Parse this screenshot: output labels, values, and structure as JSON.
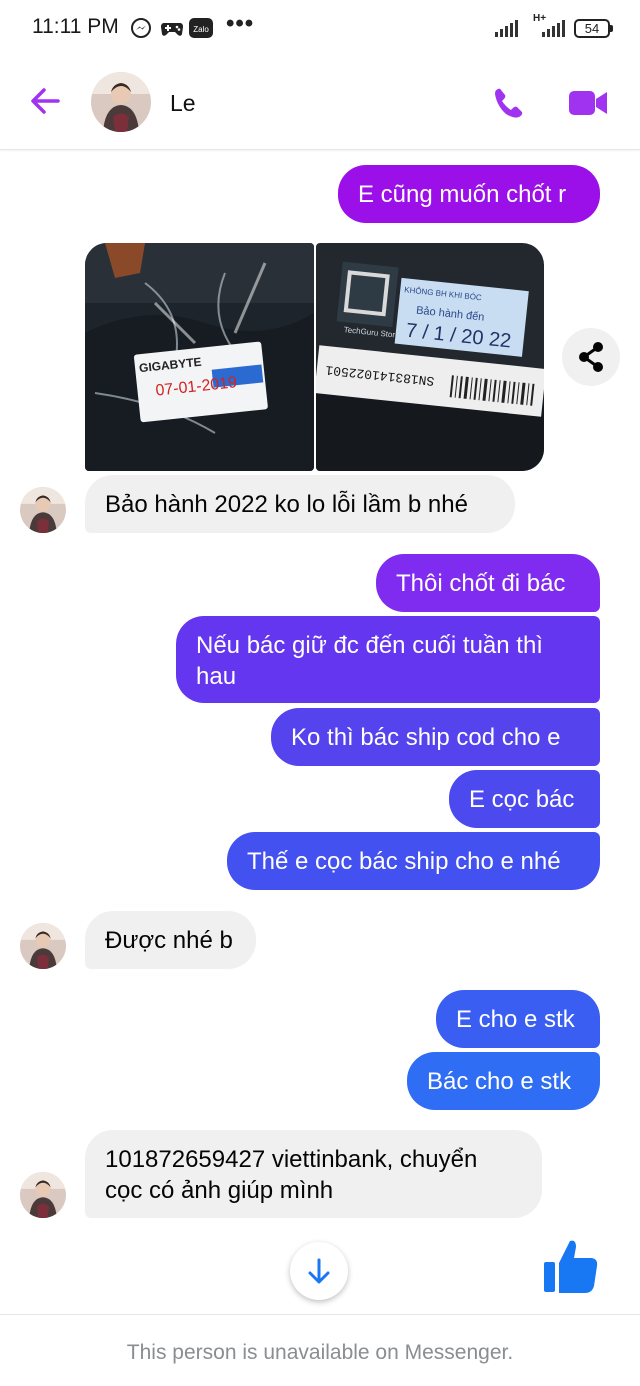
{
  "status_bar": {
    "time": "11:11 PM",
    "app_icons": [
      "messenger-icon",
      "game-controller-icon",
      "zalo-icon"
    ],
    "zalo_label": "Zalo",
    "more": "•••",
    "network": "H+",
    "battery": "54"
  },
  "header": {
    "contact_name": "Le",
    "icons": [
      "back-arrow-icon",
      "phone-icon",
      "video-camera-icon"
    ],
    "accent_color": "#a033f0"
  },
  "messages": [
    {
      "side": "out",
      "text": "E cũng muốn chốt r"
    },
    {
      "side": "in",
      "type": "photos",
      "photo1_brand": "GIGABYTE",
      "photo1_date": "07-01-2019",
      "photo2_line1": "KHÔNG BH KHI BÓC",
      "photo2_line2": "Bảo hành đến",
      "photo2_date": "7 / 1 / 20 22",
      "photo2_store": "TechGuru Store",
      "photo2_serial": "SN183141022501"
    },
    {
      "side": "in",
      "text": "Bảo hành 2022 ko lo lỗi lầm b nhé"
    },
    {
      "side": "out",
      "text": "Thôi chốt đi bác"
    },
    {
      "side": "out",
      "lines": [
        "Nếu bác giữ đc đến cuối tuần thì",
        "hau"
      ]
    },
    {
      "side": "out",
      "text": "Ko thì bác ship cod cho e"
    },
    {
      "side": "out",
      "text": "E cọc bác"
    },
    {
      "side": "out",
      "text": "Thế e cọc bác ship cho e nhé"
    },
    {
      "side": "in",
      "text": "Được nhé b"
    },
    {
      "side": "out",
      "text": "E cho e stk"
    },
    {
      "side": "out",
      "text": "Bác cho e stk"
    },
    {
      "side": "in",
      "lines": [
        "101872659427 viettinbank, chuyển",
        "cọc có ảnh giúp mình"
      ]
    }
  ],
  "bubble_colors": {
    "incoming": "#f0f0f0",
    "outgoing_gradient": [
      "#9b0fe8",
      "#7f2cf0",
      "#5b40ee",
      "#3f55f0",
      "#2f6df5"
    ]
  },
  "controls": {
    "icons": [
      "share-icon",
      "scroll-down-arrow-icon",
      "thumbs-up-icon"
    ]
  },
  "footer": {
    "text": "This person is unavailable on Messenger."
  }
}
